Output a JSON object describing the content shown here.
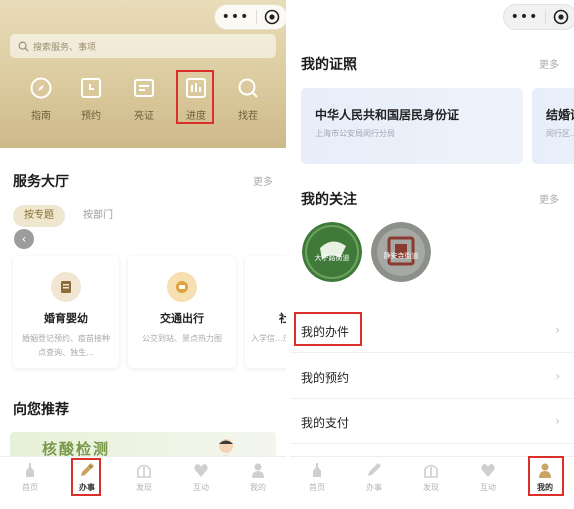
{
  "left": {
    "search": {
      "placeholder": "搜索服务、事项"
    },
    "tools": [
      {
        "label": "指南",
        "icon": "compass-icon"
      },
      {
        "label": "预约",
        "icon": "calendar-icon"
      },
      {
        "label": "亮证",
        "icon": "id-card-icon"
      },
      {
        "label": "进度",
        "icon": "progress-chart-icon"
      },
      {
        "label": "找茬",
        "icon": "search-icon"
      }
    ],
    "service_hall": {
      "title": "服务大厅",
      "more": "更多",
      "segments": [
        "按专题",
        "按部门"
      ],
      "cards": [
        {
          "title": "婚育婴幼",
          "desc": "婚姻登记预约、疫苗接种点查询、独生..."
        },
        {
          "title": "交通出行",
          "desc": "公交到站、景点热力图"
        },
        {
          "title": "社",
          "desc": "入学信...示范本..."
        }
      ]
    },
    "recommend": {
      "title": "向您推荐",
      "banner": "核酸检测"
    },
    "tabbar": [
      {
        "label": "首页",
        "icon": "home-icon"
      },
      {
        "label": "办事",
        "icon": "pen-icon"
      },
      {
        "label": "发现",
        "icon": "discover-icon"
      },
      {
        "label": "互动",
        "icon": "interact-icon"
      },
      {
        "label": "我的",
        "icon": "user-icon"
      }
    ]
  },
  "right": {
    "certs": {
      "title": "我的证照",
      "more": "更多",
      "cards": [
        {
          "title": "中华人民共和国居民身份证",
          "sub": "上海市公安局闵行分局"
        },
        {
          "title": "结婚证",
          "sub": "闵行区..."
        }
      ]
    },
    "follows": {
      "title": "我的关注",
      "more": "更多",
      "items": [
        {
          "name": "大宁路街道"
        },
        {
          "name": "静安寺街道"
        }
      ]
    },
    "list": [
      "我的办件",
      "我的预约",
      "我的支付"
    ],
    "tabbar": [
      {
        "label": "首页",
        "icon": "home-icon"
      },
      {
        "label": "办事",
        "icon": "pen-icon"
      },
      {
        "label": "发现",
        "icon": "discover-icon"
      },
      {
        "label": "互动",
        "icon": "interact-icon"
      },
      {
        "label": "我的",
        "icon": "user-icon"
      }
    ]
  },
  "capsule": {
    "dots": "•••"
  },
  "colors": {
    "highlight": "#d9302a",
    "gold_header": "#dccb9f",
    "gold_text": "#8a6d30",
    "cert_bg": "#e7eef9"
  }
}
